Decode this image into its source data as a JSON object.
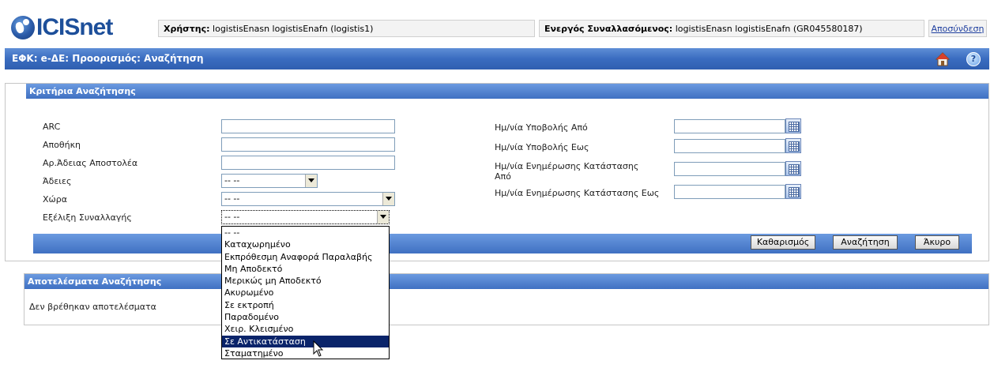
{
  "header": {
    "logo_text": "ICISnet",
    "user_label": "Χρήστης:",
    "user_value": "logistisEnasn logistisEnafn (logistis1)",
    "trader_label": "Ενεργός Συναλλασόμενος:",
    "trader_value": "logistisEnasn logistisEnafn (GR045580187)",
    "logout": "Αποσύνδεση"
  },
  "title_bar": {
    "title": "ΕΦΚ: e-ΔΕ: Προορισμός: Αναζήτηση",
    "home_icon": "home-icon",
    "help_icon": "help-icon",
    "help_glyph": "?"
  },
  "criteria": {
    "heading": "Κριτήρια Αναζήτησης",
    "arc_label": "ARC",
    "arc_value": "",
    "warehouse_label": "Αποθήκη",
    "warehouse_value": "",
    "consignor_label": "Αρ.Άδειας Αποστολέα",
    "consignor_value": "",
    "permits_label": "Άδειες",
    "permits_value": "-- --",
    "country_label": "Χώρα",
    "country_value": "-- --",
    "status_label": "Εξέλιξη Συναλλαγής",
    "status_value": "-- --",
    "submit_from_label": "Ημ/νία Υποβολής Από",
    "submit_to_label": "Ημ/νία Υποβολής Εως",
    "update_from_label": "Ημ/νία Ενημέρωσης Κατάστασης Από",
    "update_to_label": "Ημ/νία Ενημέρωσης Κατάστασης Εως",
    "clear_button": "Καθαρισμός",
    "search_button": "Αναζήτηση",
    "cancel_button": "Άκυρο"
  },
  "results": {
    "heading": "Αποτελέσματα Αναζήτησης",
    "empty_text": "Δεν βρέθηκαν αποτελέσματα"
  },
  "status_dropdown": {
    "options": [
      "-- --",
      "Καταχωρημένο",
      "Εκπρόθεσμη Αναφορά Παραλαβής",
      "Μη Αποδεκτό",
      "Μερικώς μη Αποδεκτό",
      "Ακυρωμένο",
      "Σε εκτροπή",
      "Παραδομένο",
      "Χειρ. Κλεισμένο",
      "Σε Αντικατάσταση",
      "Σταματημένο"
    ],
    "highlighted": "Σε Αντικατάσταση"
  },
  "colors": {
    "accent_blue": "#3a6cc0",
    "selection": "#0a246a"
  }
}
